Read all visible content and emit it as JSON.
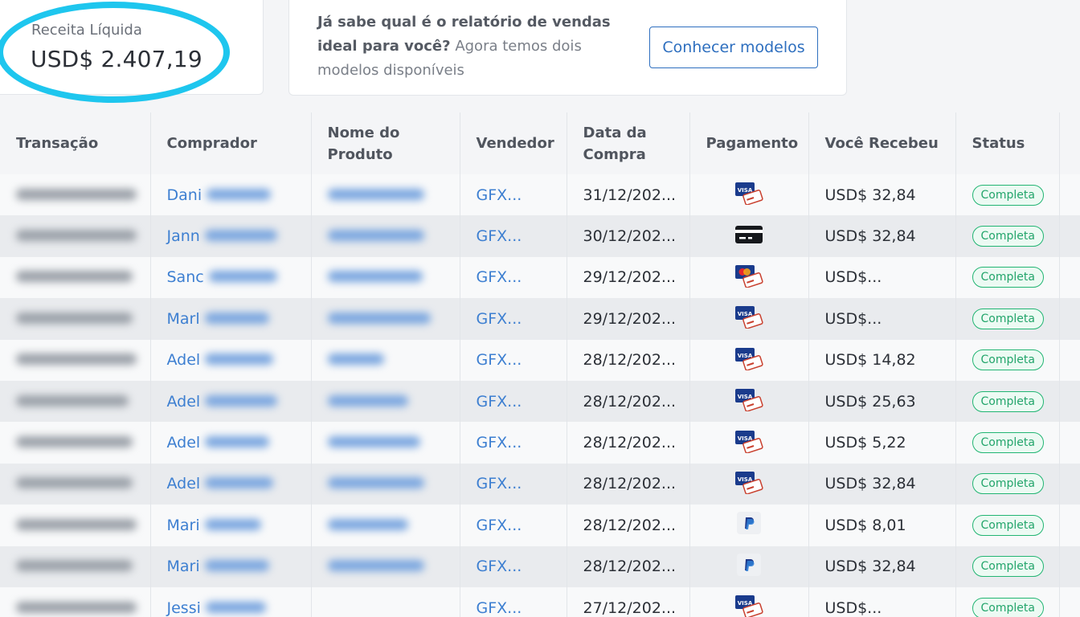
{
  "summary": {
    "label": "Receita Líquida",
    "value": "USD$ 2.407,19"
  },
  "promo": {
    "bold_text": "Já sabe qual é o relatório de vendas ideal para você?",
    "text": " Agora temos dois modelos disponíveis",
    "button_label": "Conhecer modelos"
  },
  "table": {
    "headers": {
      "transaction": "Transação",
      "buyer": "Comprador",
      "product_line1": "Nome do",
      "product_line2": "Produto",
      "seller": "Vendedor",
      "date_line1": "Data da",
      "date_line2": "Compra",
      "payment": "Pagamento",
      "received": "Você Recebeu",
      "status": "Status"
    },
    "rows": [
      {
        "buyer": "Dani",
        "seller": "GFX...",
        "date": "31/12/202...",
        "payment_icon": "visa-card-icon",
        "received": "USD$ 32,84",
        "status": "Completa"
      },
      {
        "buyer": "Jann",
        "seller": "GFX...",
        "date": "30/12/202...",
        "payment_icon": "generic-card-icon",
        "received": "USD$ 32,84",
        "status": "Completa"
      },
      {
        "buyer": "Sanc",
        "seller": "GFX...",
        "date": "29/12/202...",
        "payment_icon": "mastercard-icon",
        "received": "USD$...",
        "status": "Completa"
      },
      {
        "buyer": "Marl",
        "seller": "GFX...",
        "date": "29/12/202...",
        "payment_icon": "visa-card-icon",
        "received": "USD$...",
        "status": "Completa"
      },
      {
        "buyer": "Adel",
        "seller": "GFX...",
        "date": "28/12/202...",
        "payment_icon": "visa-card-icon",
        "received": "USD$ 14,82",
        "status": "Completa"
      },
      {
        "buyer": "Adel",
        "seller": "GFX...",
        "date": "28/12/202...",
        "payment_icon": "visa-card-icon",
        "received": "USD$ 25,63",
        "status": "Completa"
      },
      {
        "buyer": "Adel",
        "seller": "GFX...",
        "date": "28/12/202...",
        "payment_icon": "visa-card-icon",
        "received": "USD$ 5,22",
        "status": "Completa"
      },
      {
        "buyer": "Adel",
        "seller": "GFX...",
        "date": "28/12/202...",
        "payment_icon": "visa-card-icon",
        "received": "USD$ 32,84",
        "status": "Completa"
      },
      {
        "buyer": "Mari",
        "seller": "GFX...",
        "date": "28/12/202...",
        "payment_icon": "paypal-icon",
        "received": "USD$ 8,01",
        "status": "Completa"
      },
      {
        "buyer": "Mari",
        "seller": "GFX...",
        "date": "28/12/202...",
        "payment_icon": "paypal-icon",
        "received": "USD$ 32,84",
        "status": "Completa"
      },
      {
        "buyer": "Jessi",
        "seller": "GFX...",
        "date": "27/12/202...",
        "payment_icon": "visa-card-icon",
        "received": "USD$...",
        "status": "Completa"
      }
    ]
  },
  "colors": {
    "highlight": "#1ec6ee",
    "link": "#3d7fd1",
    "status_green": "#22b573"
  }
}
